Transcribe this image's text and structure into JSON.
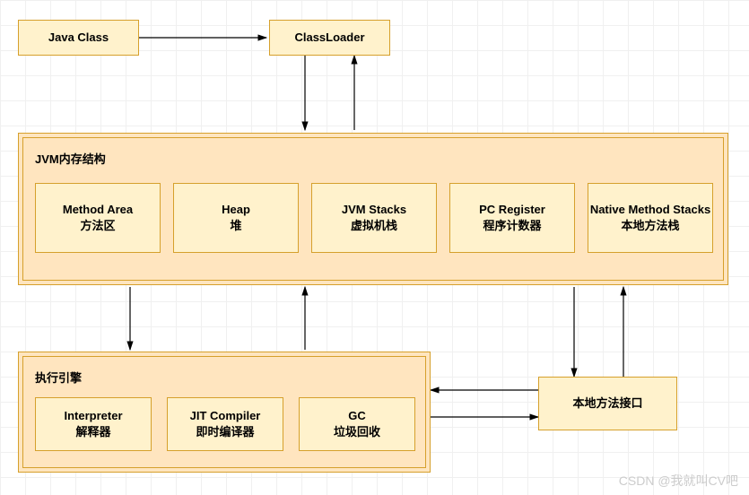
{
  "topRow": {
    "javaClass": "Java Class",
    "classLoader": "ClassLoader"
  },
  "memory": {
    "title": "JVM内存结构",
    "areas": {
      "methodArea": {
        "en": "Method Area",
        "zh": "方法区"
      },
      "heap": {
        "en": "Heap",
        "zh": "堆"
      },
      "jvmStacks": {
        "en": "JVM Stacks",
        "zh": "虚拟机栈"
      },
      "pcRegister": {
        "en": "PC Register",
        "zh": "程序计数器"
      },
      "nativeStacks": {
        "en": "Native Method Stacks",
        "zh": "本地方法栈"
      }
    }
  },
  "engine": {
    "title": "执行引擎",
    "components": {
      "interpreter": {
        "en": "Interpreter",
        "zh": "解释器"
      },
      "jit": {
        "en": "JIT Compiler",
        "zh": "即时编译器"
      },
      "gc": {
        "en": "GC",
        "zh": "垃圾回收"
      }
    }
  },
  "nativeInterface": "本地方法接口",
  "watermark": "CSDN @我就叫CV吧"
}
